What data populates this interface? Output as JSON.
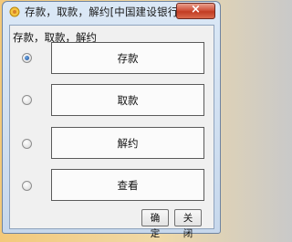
{
  "window": {
    "title": "存款，取款，解约[中国建设银行]",
    "close_label": "×"
  },
  "group": {
    "label": "存款，取款，解约"
  },
  "options": [
    {
      "label": "存款",
      "selected": true
    },
    {
      "label": "取款",
      "selected": false
    },
    {
      "label": "解约",
      "selected": false
    },
    {
      "label": "查看",
      "selected": false
    }
  ],
  "footer": {
    "ok_label": "确定",
    "close_label": "关闭"
  }
}
